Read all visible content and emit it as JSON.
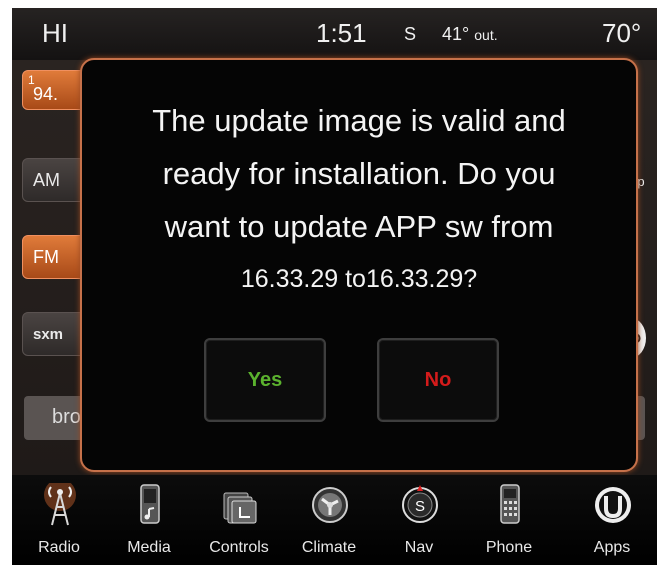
{
  "status_bar": {
    "left_text": "HI",
    "time": "1:51",
    "compass": "S",
    "temp_out": "41°",
    "temp_out_suffix": "out.",
    "right_temp": "70°"
  },
  "background": {
    "preset_number": "1",
    "preset_station": "94.",
    "bands": [
      "AM",
      "FM",
      "sxm"
    ],
    "map_label": "map",
    "hd_label": "HD",
    "strip_left": "bro",
    "strip_right": "o"
  },
  "dialog": {
    "message_lines": [
      "The update image is valid and",
      "ready for installation.  Do you",
      "want to update APP sw from",
      "16.33.29 to16.33.29?"
    ],
    "yes_label": "Yes",
    "no_label": "No",
    "colors": {
      "yes": "#5bb22e",
      "no": "#d41b1b",
      "border": "#c6714a"
    }
  },
  "nav": {
    "items": [
      {
        "label": "Radio",
        "icon": "radio-tower-icon"
      },
      {
        "label": "Media",
        "icon": "media-player-icon"
      },
      {
        "label": "Controls",
        "icon": "seat-controls-icon"
      },
      {
        "label": "Climate",
        "icon": "climate-fan-icon"
      },
      {
        "label": "Nav",
        "icon": "compass-icon"
      },
      {
        "label": "Phone",
        "icon": "phone-icon"
      },
      {
        "label": "Apps",
        "icon": "uconnect-apps-icon"
      }
    ]
  }
}
